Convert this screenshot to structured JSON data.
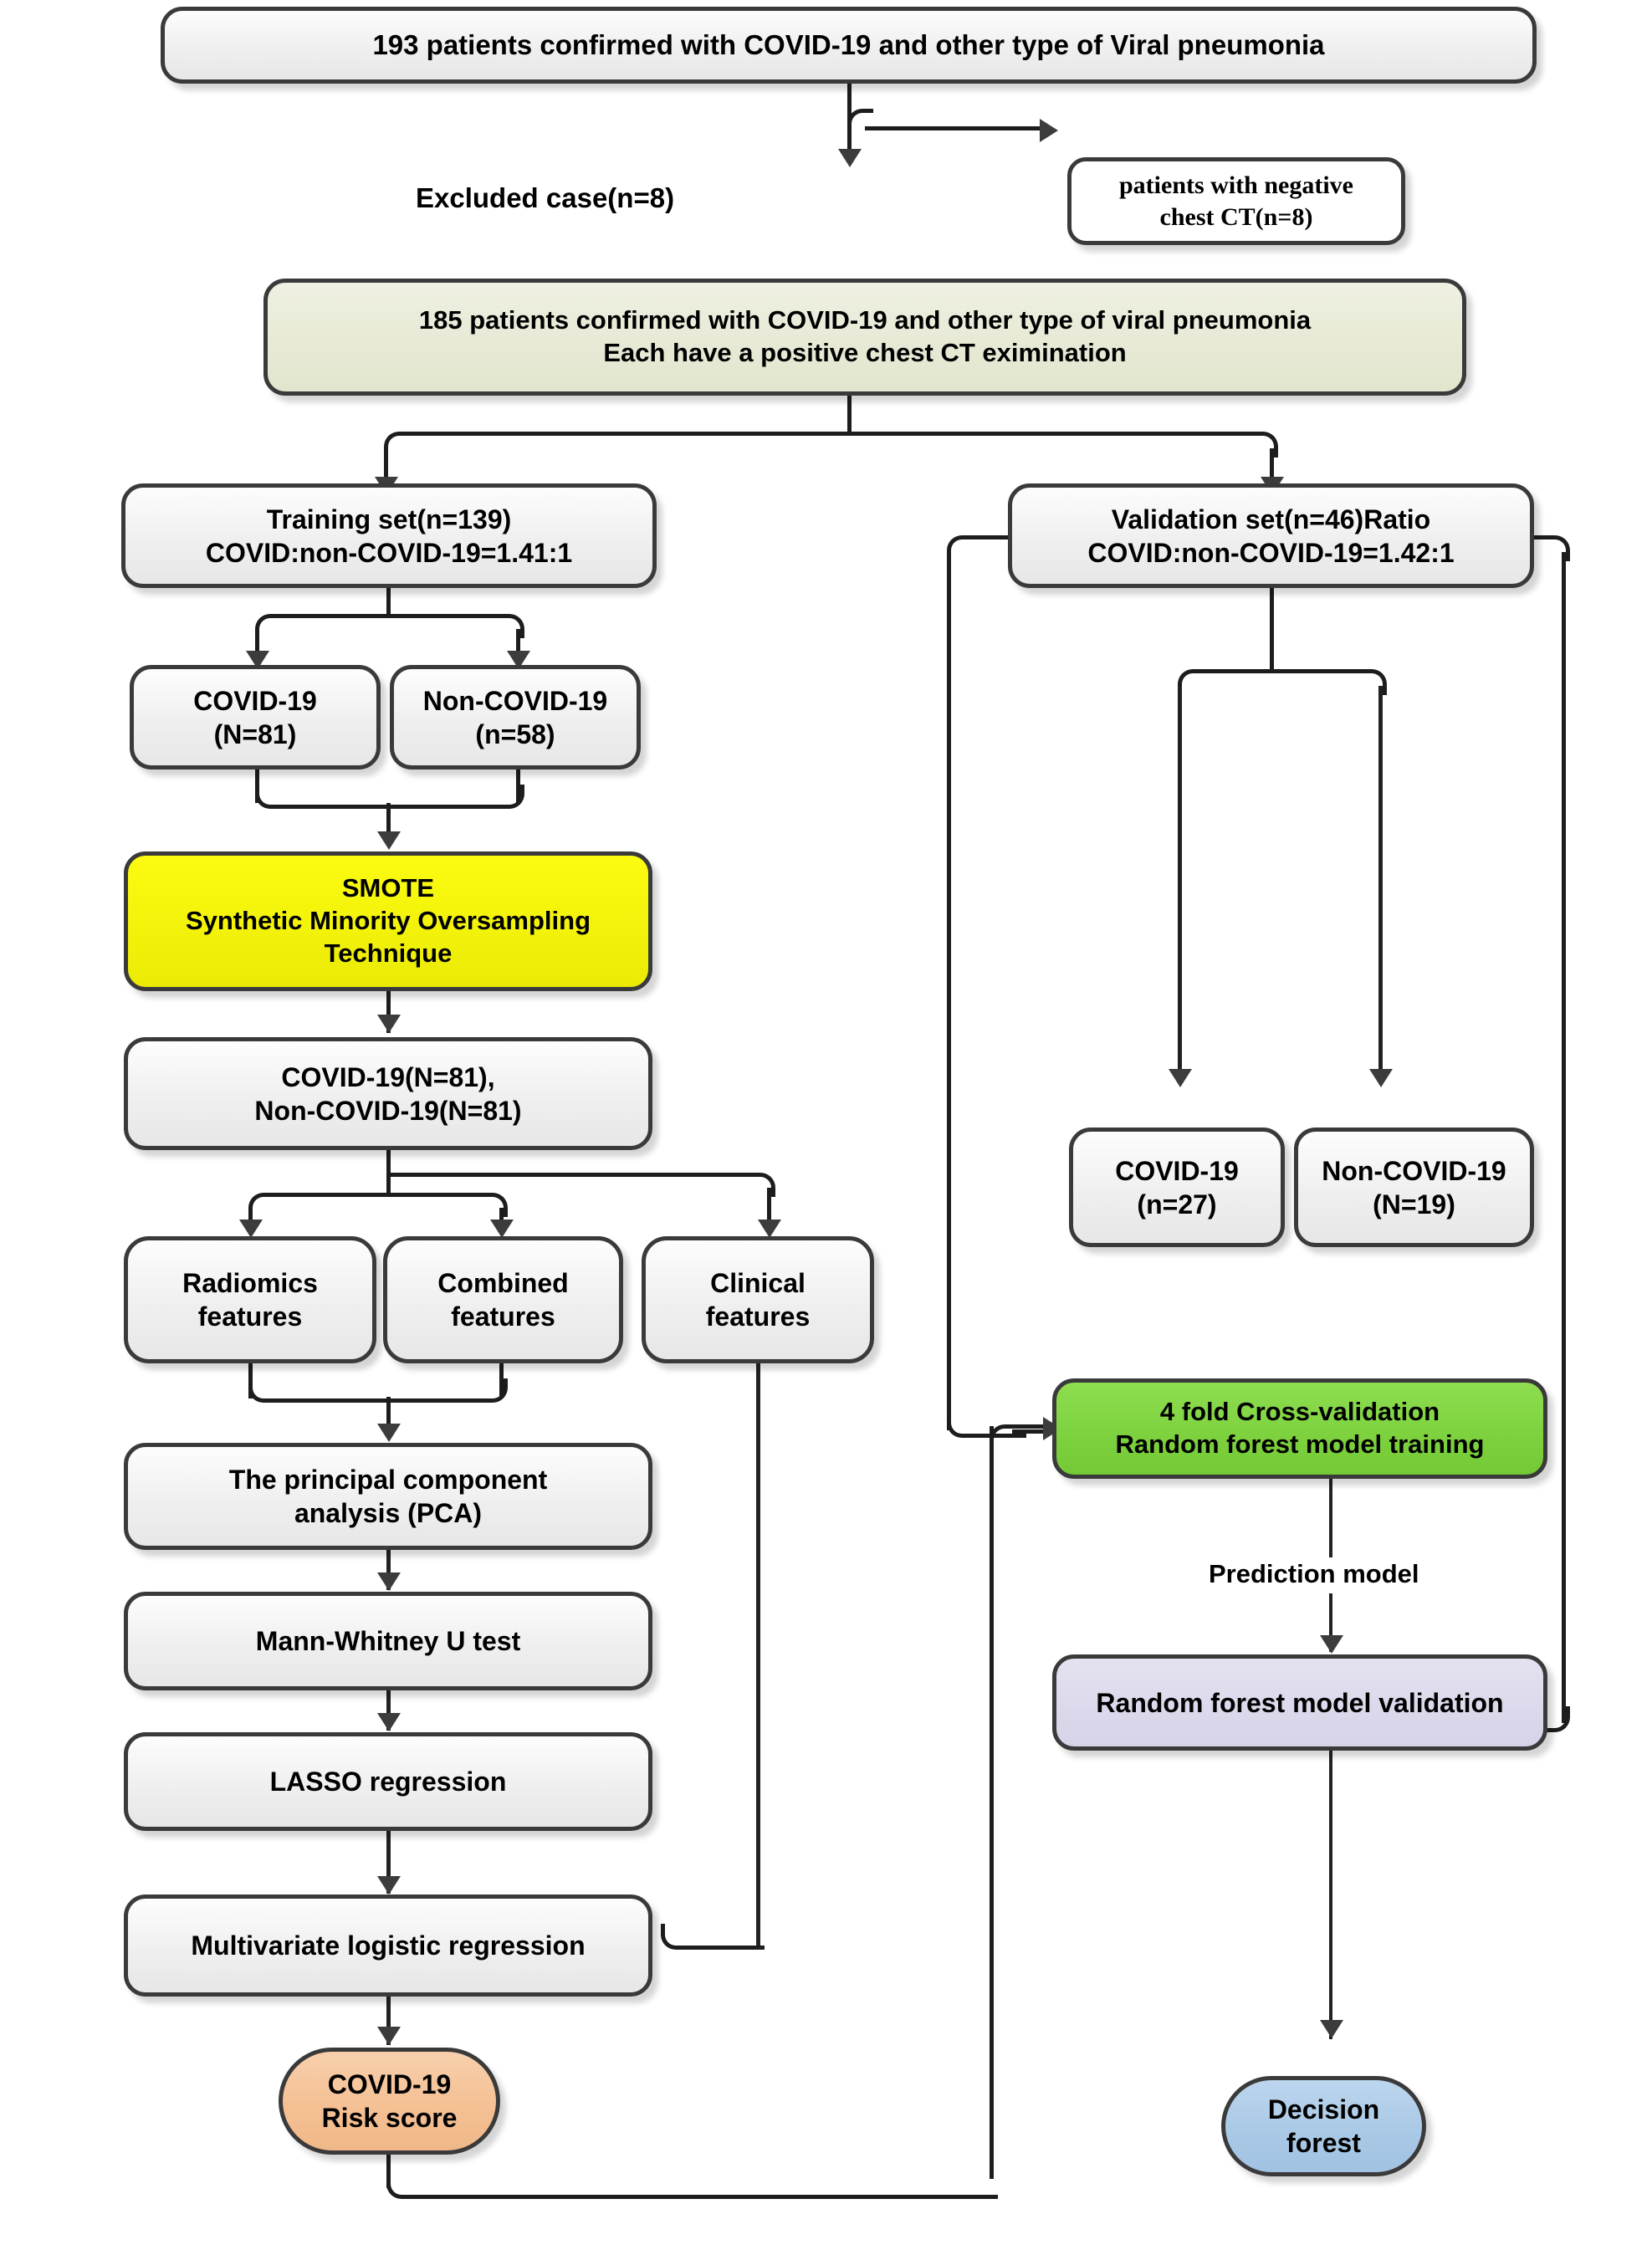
{
  "diagram": {
    "title": "COVID-19 radiomics study flowchart",
    "colors": {
      "olive": "#E4E7CF",
      "yellow": "#F2F20A",
      "green": "#7ED23F",
      "lilac": "#DCD9EC",
      "orange": "#F4C094",
      "blue": "#AAC9E6",
      "node_border": "#3A3A3A",
      "connector": "#1D1D1D"
    },
    "nodes": {
      "cohort_total": "193 patients confirmed with COVID-19 and other type of Viral pneumonia",
      "excluded_box": "patients with negative\nchest CT(n=8)",
      "cohort_included": "185 patients confirmed with COVID-19 and other type of viral pneumonia\nEach have a positive chest CT eximination",
      "training_set": "Training set(n=139)\nCOVID:non-COVID-19=1.41:1",
      "validation_set": "Validation set(n=46)Ratio\nCOVID:non-COVID-19=1.42:1",
      "train_covid": "COVID-19\n(N=81)",
      "train_noncovid": "Non-COVID-19\n(n=58)",
      "smote": "SMOTE\nSynthetic Minority Oversampling\nTechnique",
      "balanced": "COVID-19(N=81),\nNon-COVID-19(N=81)",
      "radiomics_features": "Radiomics\nfeatures",
      "combined_features": "Combined\nfeatures",
      "clinical_features": "Clinical\nfeatures",
      "pca": "The principal component\nanalysis (PCA)",
      "mann_whitney": "Mann-Whitney U test",
      "lasso": "LASSO regression",
      "multivariate": "Multivariate logistic regression",
      "risk_score": "COVID-19\nRisk score",
      "val_covid": "COVID-19\n(n=27)",
      "val_noncovid": "Non-COVID-19\n(N=19)",
      "cross_validation": "4 fold Cross-validation\nRandom forest model training",
      "model_validation": "Random forest model validation",
      "decision_forest": "Decision\nforest"
    },
    "labels": {
      "excluded_case": "Excluded case(n=8)",
      "prediction_model": "Prediction model"
    }
  }
}
